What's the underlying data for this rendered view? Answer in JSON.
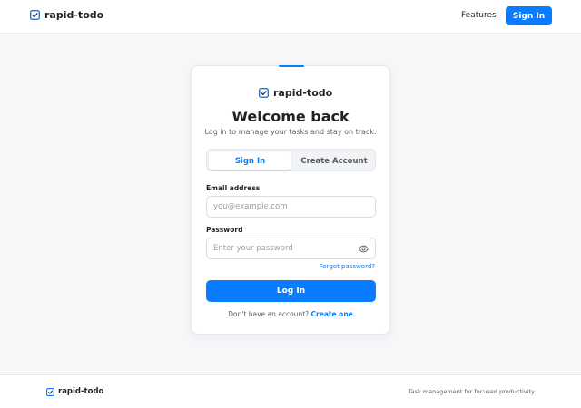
{
  "header": {
    "brand_name": "rapid-todo",
    "nav_features": "Features",
    "sign_in_label": "Sign In"
  },
  "card": {
    "brand_name": "rapid-todo",
    "title": "Welcome back",
    "subtitle": "Log in to manage your tasks and stay on track.",
    "tabs": [
      {
        "label": "Sign In",
        "active": true
      },
      {
        "label": "Create Account",
        "active": false
      }
    ],
    "email": {
      "label": "Email address",
      "placeholder": "you@example.com",
      "value": ""
    },
    "password": {
      "label": "Password",
      "placeholder": "Enter your password",
      "value": ""
    },
    "forgot_label": "Forgot password?",
    "login_label": "Log In",
    "signup_prompt": "Don't have an account?",
    "signup_link": "Create one"
  },
  "footer": {
    "brand_name": "rapid-todo",
    "tagline": "Task management for focused productivity."
  },
  "icons": {
    "brand": "check-square-icon",
    "password_toggle": "eye-icon"
  },
  "colors": {
    "accent": "#0a7cff",
    "background": "#f6f7f9",
    "text": "#1f2328",
    "muted": "#57606a"
  }
}
